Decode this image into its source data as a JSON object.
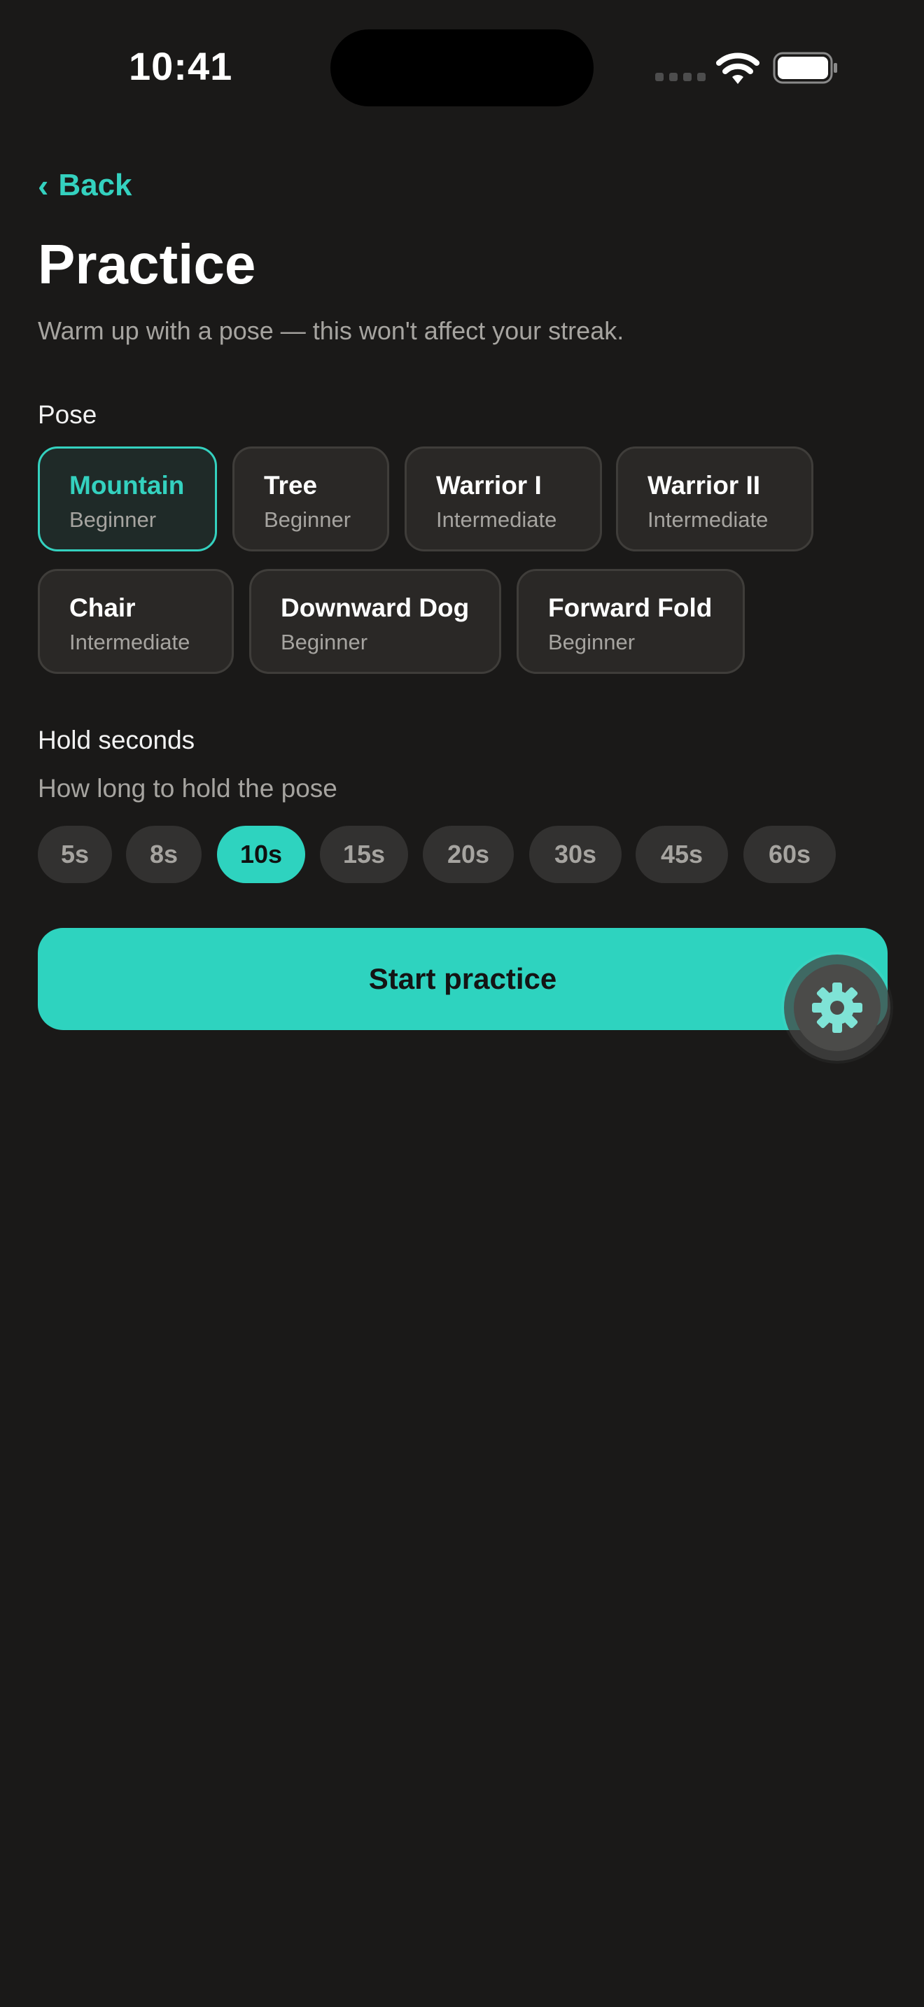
{
  "status_bar": {
    "time": "10:41"
  },
  "nav": {
    "back_label": "Back"
  },
  "header": {
    "title": "Practice",
    "subtitle": "Warm up with a pose — this won't affect your streak."
  },
  "pose_section": {
    "label": "Pose",
    "poses": [
      {
        "name": "Mountain",
        "level": "Beginner",
        "selected": true
      },
      {
        "name": "Tree",
        "level": "Beginner",
        "selected": false
      },
      {
        "name": "Warrior I",
        "level": "Intermediate",
        "selected": false
      },
      {
        "name": "Warrior II",
        "level": "Intermediate",
        "selected": false
      },
      {
        "name": "Chair",
        "level": "Intermediate",
        "selected": false
      },
      {
        "name": "Downward Dog",
        "level": "Beginner",
        "selected": false
      },
      {
        "name": "Forward Fold",
        "level": "Beginner",
        "selected": false
      }
    ]
  },
  "hold_section": {
    "label": "Hold seconds",
    "help": "How long to hold the pose",
    "options": [
      "5s",
      "8s",
      "10s",
      "15s",
      "20s",
      "30s",
      "45s",
      "60s"
    ],
    "selected": "10s"
  },
  "start_button": {
    "label": "Start practice"
  },
  "fab": {
    "icon": "gear-icon"
  },
  "colors": {
    "accent": "#2ed3bf",
    "background": "#1a1918",
    "card": "#2a2826"
  }
}
